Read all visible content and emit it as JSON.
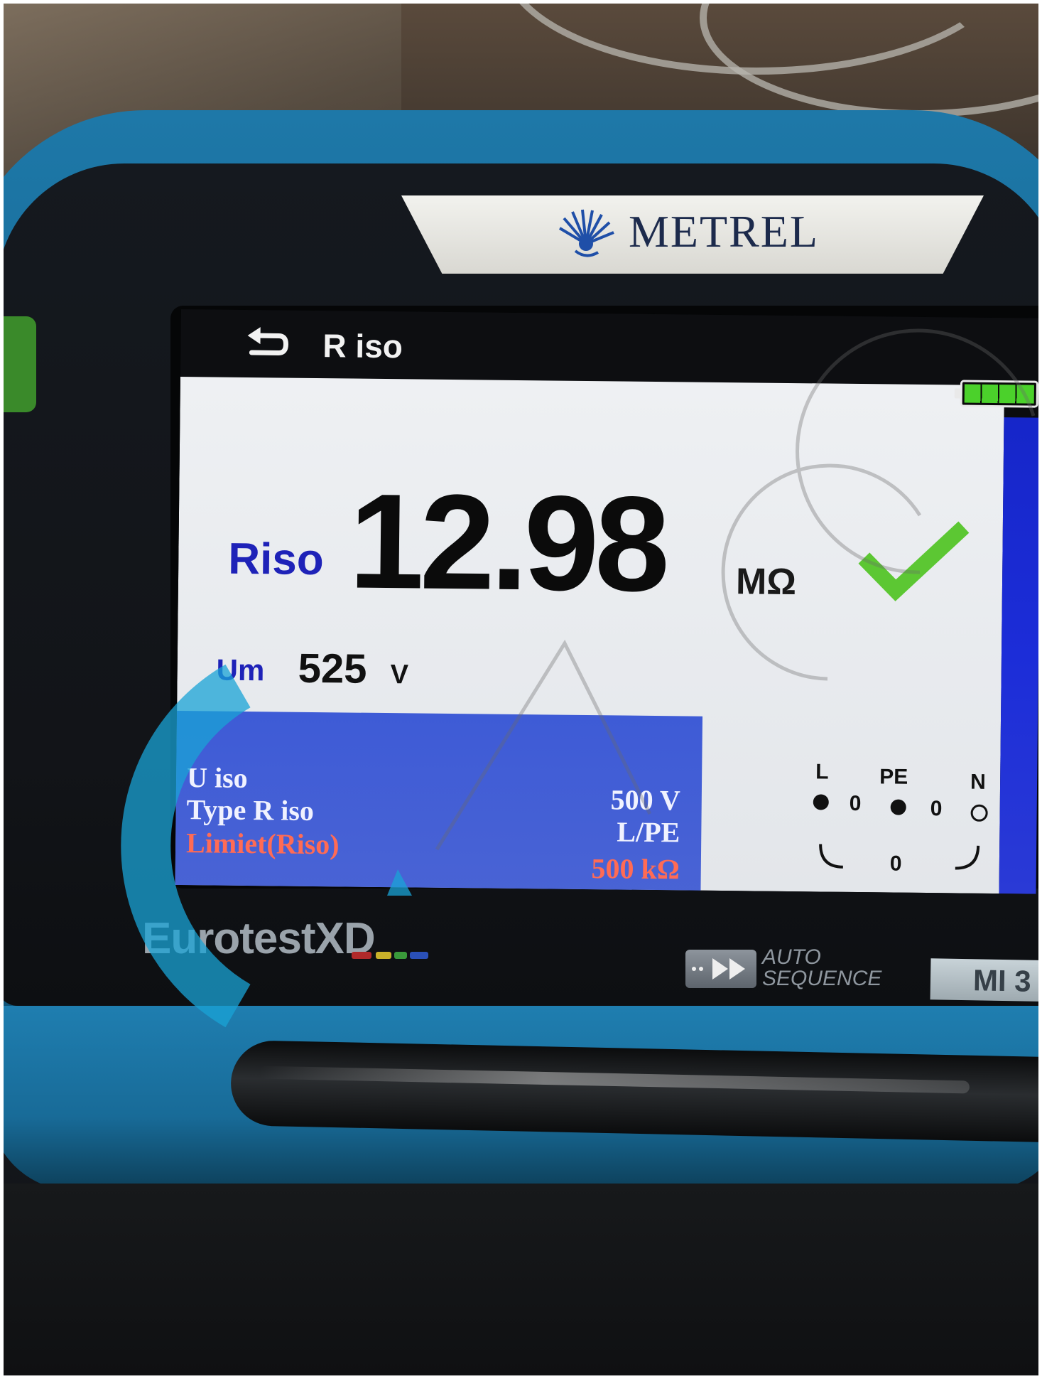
{
  "device": {
    "brand_logo": "METREL",
    "model_name": "EurotestXD",
    "auto_sequence_label": [
      "AUTO",
      "SEQUENCE"
    ],
    "model_number_partial": "MI 3"
  },
  "screen": {
    "title": "R iso",
    "battery_level": 1.0,
    "result": {
      "label": "Riso",
      "value": "12.98",
      "unit": "MΩ",
      "status": "pass"
    },
    "measured": {
      "label": "Um",
      "value": "525",
      "unit": "V"
    },
    "parameters": [
      {
        "name": "U iso",
        "value": "500 V",
        "color": "#f0f2ff"
      },
      {
        "name": "Type R iso",
        "value": "L/PE",
        "color": "#f0f2ff"
      },
      {
        "name": "Limiet(Riso)",
        "value": "500 kΩ",
        "color": "#ff6b55"
      }
    ],
    "terminals": {
      "labels": [
        "L",
        "PE",
        "N"
      ],
      "values": [
        "0",
        "0",
        "0"
      ]
    }
  },
  "icons": {
    "back": "back-arrow-icon",
    "battery": "battery-icon",
    "check": "check-icon",
    "logo": "metrel-logo-icon"
  },
  "colors": {
    "accent_blue": "#1e22b8",
    "panel_blue": "#4d66d4",
    "pass_green": "#5cc733",
    "limit_red": "#ff6b55",
    "bumper_blue": "#1e78a8"
  }
}
